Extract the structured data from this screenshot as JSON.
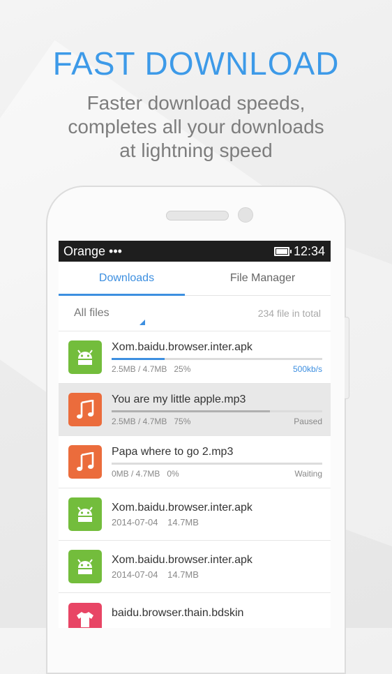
{
  "promo": {
    "headline": "FAST DOWNLOAD",
    "sub_line1": "Faster download speeds,",
    "sub_line2": "completes all your downloads",
    "sub_line3": "at lightning speed"
  },
  "status_bar": {
    "carrier": "Orange •••",
    "time": "12:34",
    "battery_icon": "battery-icon"
  },
  "tabs": [
    {
      "label": "Downloads",
      "active": true
    },
    {
      "label": "File Manager",
      "active": false
    }
  ],
  "filter": {
    "selected": "All files",
    "total": "234 file in total"
  },
  "files": [
    {
      "name": "Xom.baidu.browser.inter.apk",
      "type": "apk",
      "icon": "android-icon",
      "size": "2.5MB / 4.7MB",
      "percent": "25%",
      "progress": 0.25,
      "status": "500kb/s",
      "status_kind": "speed"
    },
    {
      "name": "You are my little apple.mp3",
      "type": "mp3",
      "icon": "music-note-icon",
      "size": "2.5MB / 4.7MB",
      "percent": "75%",
      "progress": 0.75,
      "status": "Paused",
      "status_kind": "paused"
    },
    {
      "name": "Papa where to go 2.mp3",
      "type": "mp3",
      "icon": "music-note-icon",
      "size": "0MB / 4.7MB",
      "percent": "0%",
      "progress": 0,
      "status": "Waiting",
      "status_kind": "waiting"
    },
    {
      "name": "Xom.baidu.browser.inter.apk",
      "type": "apk",
      "icon": "android-icon",
      "date": "2014-07-04",
      "size": "14.7MB"
    },
    {
      "name": "Xom.baidu.browser.inter.apk",
      "type": "apk",
      "icon": "android-icon",
      "date": "2014-07-04",
      "size": "14.7MB"
    },
    {
      "name": "baidu.browser.thain.bdskin",
      "type": "skin",
      "icon": "shirt-icon"
    }
  ],
  "colors": {
    "accent": "#3d8fe0",
    "apk": "#73bd3c",
    "mp3": "#eb6c3c",
    "skin": "#e84565",
    "headline": "#3d9ae8"
  }
}
